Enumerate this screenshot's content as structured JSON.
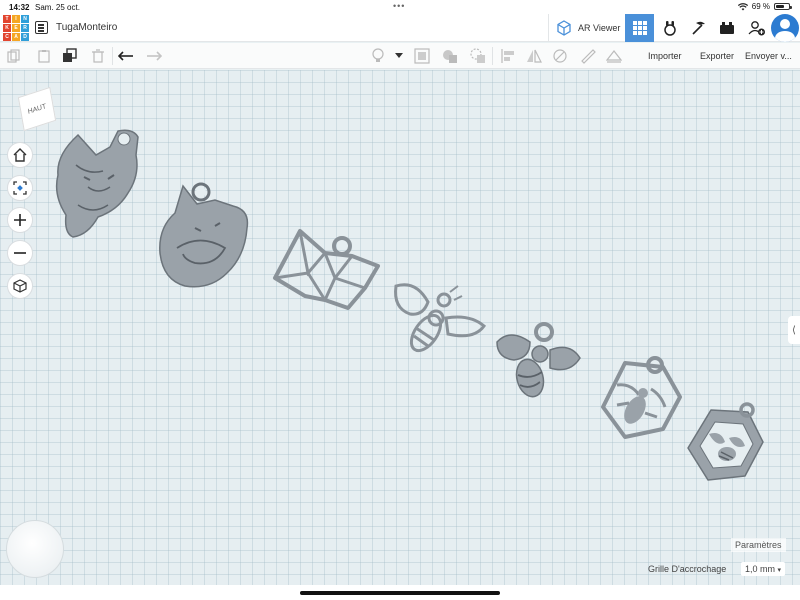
{
  "status_bar": {
    "time": "14:32",
    "date": "Sam. 25 oct.",
    "battery": "69 %",
    "battery_level": 0.69
  },
  "app": {
    "logo_letters": [
      "T",
      "I",
      "N",
      "K",
      "E",
      "R",
      "C",
      "A",
      "D"
    ],
    "logo_colors": [
      "#e2452f",
      "#f5a623",
      "#2f9fd9",
      "#e2452f",
      "#f5a623",
      "#2f9fd9",
      "#e2452f",
      "#f5a623",
      "#2f9fd9"
    ],
    "design_name": "TugaMonteiro",
    "ar_viewer_label": "AR Viewer",
    "accent_color": "#4a90d9"
  },
  "toolbar": {
    "import_label": "Importer",
    "export_label": "Exporter",
    "send_label": "Envoyer v..."
  },
  "workplane": {
    "viewcube_label": "HAUT",
    "objects": [
      "renard",
      "renard couché",
      "renard géométrique",
      "abeille",
      "abeille pleine",
      "abeille hexagone",
      "abeille hexagone pleine"
    ],
    "shape_color": "#9aa2a9"
  },
  "settings": {
    "params_label": "Paramètres",
    "snap_grid_label": "Grille D'accrochage",
    "snap_grid_value": "1,0 mm"
  }
}
